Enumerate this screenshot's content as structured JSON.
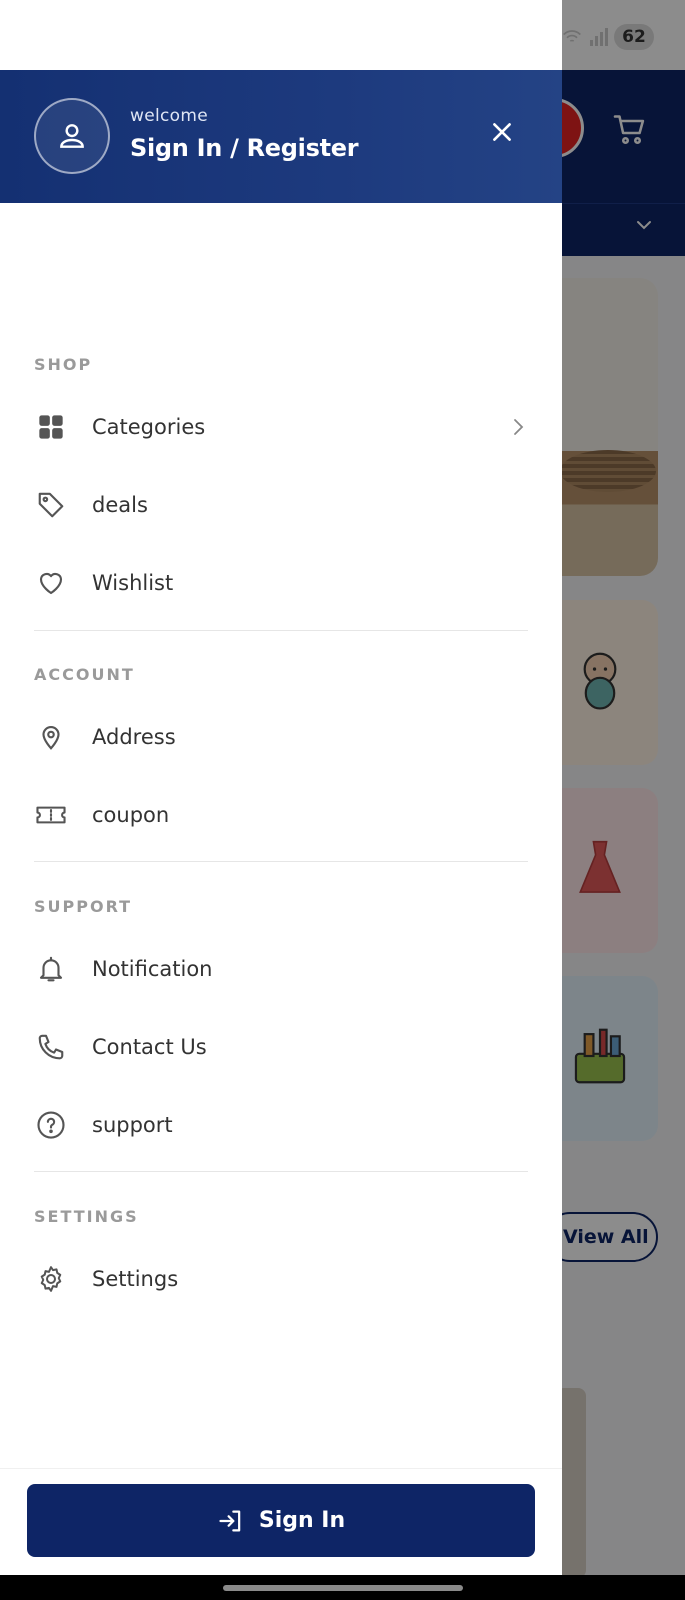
{
  "status_bar": {
    "battery": "62"
  },
  "drawer": {
    "header": {
      "welcome": "welcome",
      "sign_in_register": "Sign In / Register"
    },
    "sections": {
      "shop": {
        "title": "SHOP",
        "items": [
          {
            "label": "Categories",
            "icon": "grid-icon",
            "has_chevron": true
          },
          {
            "label": "deals",
            "icon": "tag-icon"
          },
          {
            "label": "Wishlist",
            "icon": "heart-icon"
          }
        ]
      },
      "account": {
        "title": "ACCOUNT",
        "items": [
          {
            "label": "Address",
            "icon": "location-pin-icon"
          },
          {
            "label": "coupon",
            "icon": "ticket-icon"
          }
        ]
      },
      "support": {
        "title": "SUPPORT",
        "items": [
          {
            "label": "Notification",
            "icon": "bell-icon"
          },
          {
            "label": "Contact Us",
            "icon": "phone-icon"
          },
          {
            "label": "support",
            "icon": "question-circle-icon"
          }
        ]
      },
      "settings": {
        "title": "SETTINGS",
        "items": [
          {
            "label": "Settings",
            "icon": "gear-icon"
          }
        ]
      }
    },
    "footer": {
      "sign_in_button": "Sign In"
    }
  },
  "background": {
    "view_all": "View All"
  },
  "colors": {
    "primary": "#0e2566",
    "header_gradient_start": "#143072",
    "header_gradient_end": "#244385",
    "section_title": "#9a9a9a",
    "menu_text": "#333333"
  }
}
